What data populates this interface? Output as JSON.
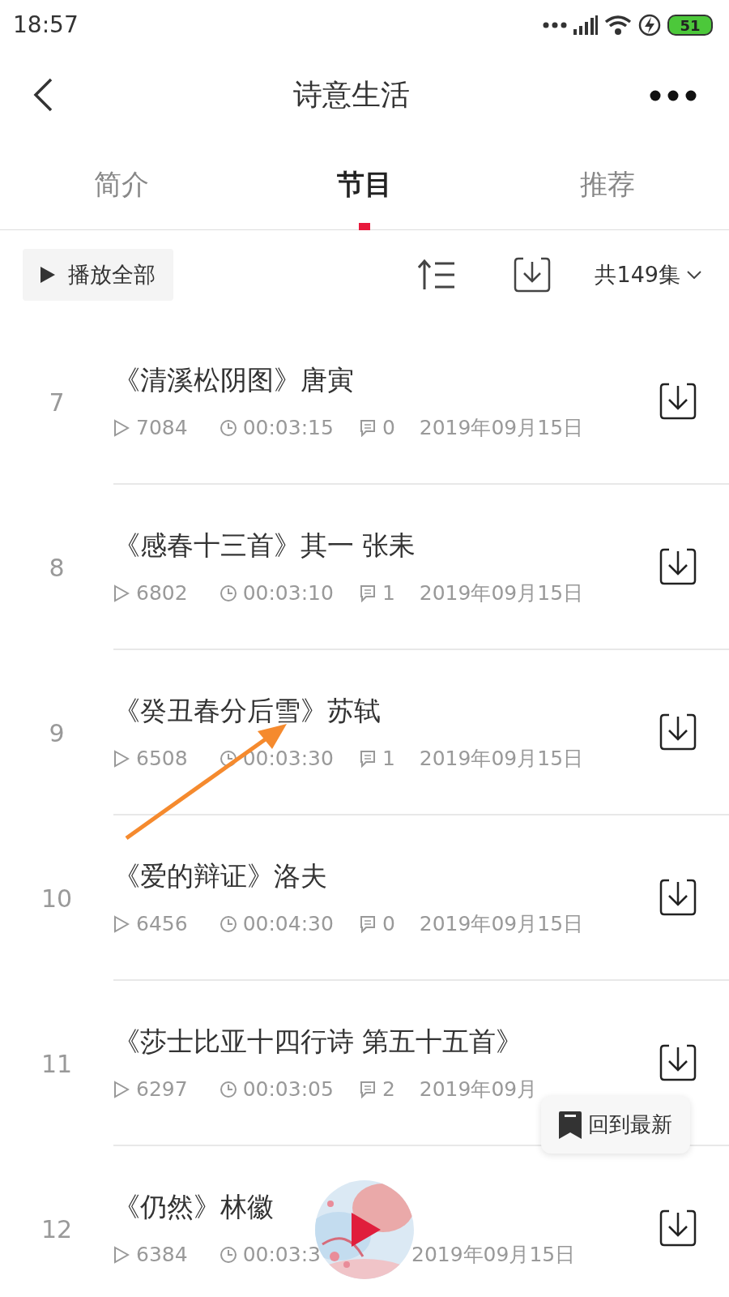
{
  "status_bar": {
    "time": "18:57",
    "battery": "51"
  },
  "header": {
    "title": "诗意生活"
  },
  "tabs": [
    {
      "label": "简介",
      "selected": false
    },
    {
      "label": "节目",
      "selected": true
    },
    {
      "label": "推荐",
      "selected": false
    }
  ],
  "toolbar": {
    "play_all": "播放全部",
    "episode_count": "共149集"
  },
  "episodes": [
    {
      "number": "7",
      "title": "《清溪松阴图》唐寅",
      "plays": "7084",
      "duration": "00:03:15",
      "comments": "0",
      "date": "2019年09月15日"
    },
    {
      "number": "8",
      "title": "《感春十三首》其一 张耒",
      "plays": "6802",
      "duration": "00:03:10",
      "comments": "1",
      "date": "2019年09月15日"
    },
    {
      "number": "9",
      "title": "《癸丑春分后雪》苏轼",
      "plays": "6508",
      "duration": "00:03:30",
      "comments": "1",
      "date": "2019年09月15日"
    },
    {
      "number": "10",
      "title": "《爱的辩证》洛夫",
      "plays": "6456",
      "duration": "00:04:30",
      "comments": "0",
      "date": "2019年09月15日"
    },
    {
      "number": "11",
      "title": "《莎士比亚十四行诗 第五十五首》",
      "plays": "6297",
      "duration": "00:03:05",
      "comments": "2",
      "date": "2019年09月"
    },
    {
      "number": "12",
      "title": "《仍然》林徽",
      "plays": "6384",
      "duration": "00:03:3",
      "date": "2019年09月15日"
    }
  ],
  "back_to_latest": {
    "label": "回到最新"
  }
}
